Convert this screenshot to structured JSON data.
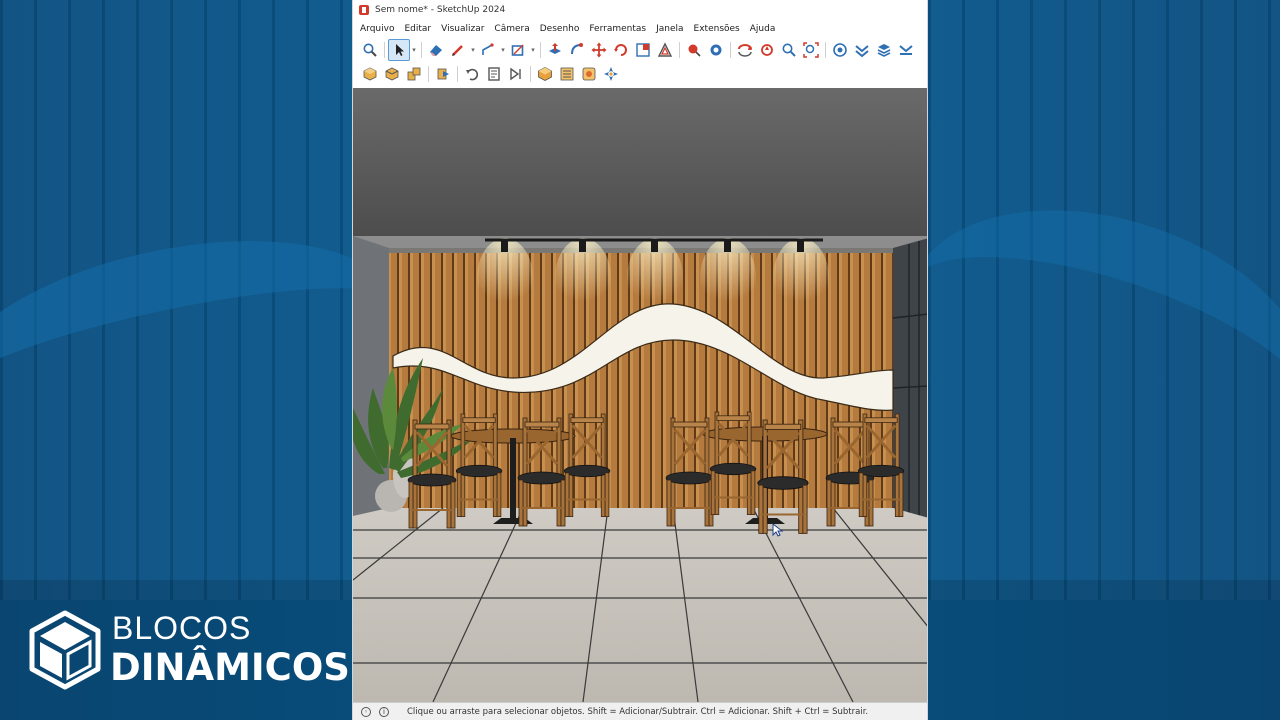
{
  "window": {
    "title": "Sem nome* - SketchUp 2024"
  },
  "menu": {
    "items": [
      "Arquivo",
      "Editar",
      "Visualizar",
      "Câmera",
      "Desenho",
      "Ferramentas",
      "Janela",
      "Extensões",
      "Ajuda"
    ]
  },
  "toolbar_row1": {
    "icons": [
      "search-icon",
      "select-icon",
      "eraser-icon",
      "pencil-icon",
      "line-icon",
      "rectangle-icon",
      "push-pull-icon",
      "follow-me-icon",
      "move-icon",
      "rotate-icon",
      "scale-icon",
      "offset-icon",
      "tape-measure-icon",
      "paint-bucket-icon",
      "orbit-icon",
      "pan-icon",
      "zoom-icon",
      "zoom-extents-icon",
      "components-icon",
      "styles-icon",
      "layers-icon",
      "scenes-icon"
    ]
  },
  "toolbar_row2": {
    "icons": [
      "iso-view-icon",
      "top-view-icon",
      "front-view-icon",
      "section-plane-icon",
      "undo-icon",
      "model-info-icon",
      "display-section-icon",
      "component-box-icon",
      "layers-panel-icon",
      "materials-icon",
      "outliner-icon"
    ]
  },
  "statusbar": {
    "hint": "Clique ou arraste para selecionar objetos. Shift = Adicionar/Subtrair. Ctrl = Adicionar. Shift + Ctrl = Subtrair."
  },
  "logo": {
    "line1": "BLOCOS",
    "line2": "DINÂMICOS"
  },
  "colors": {
    "background_blue": "#0a5a8f",
    "wood": "#b57a3e",
    "ceiling": "#5b5b5b",
    "floor": "#c9c5be",
    "toolbar_red": "#d23a2b",
    "toolbar_blue": "#2f6fb3"
  }
}
